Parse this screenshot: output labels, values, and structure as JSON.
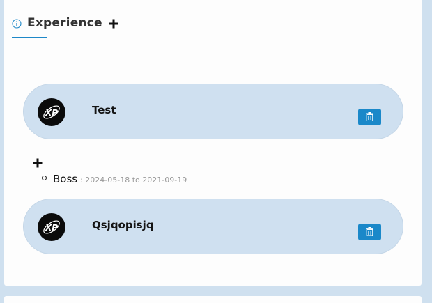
{
  "section": {
    "title": "Experience"
  },
  "experiences": [
    {
      "name": "Test",
      "logo_text": "XP"
    },
    {
      "name": "Qsjqopisjq",
      "logo_text": "XP"
    }
  ],
  "roles": [
    {
      "title": "Boss",
      "dates": ": 2024-05-18 to 2021-09-19"
    }
  ],
  "colors": {
    "accent": "#1e88c8",
    "card_bg": "#cfe0f0",
    "page_bg": "#cfe0ef"
  },
  "icons": {
    "header": "info-icon",
    "add": "plus-icon",
    "delete": "trash-icon"
  }
}
